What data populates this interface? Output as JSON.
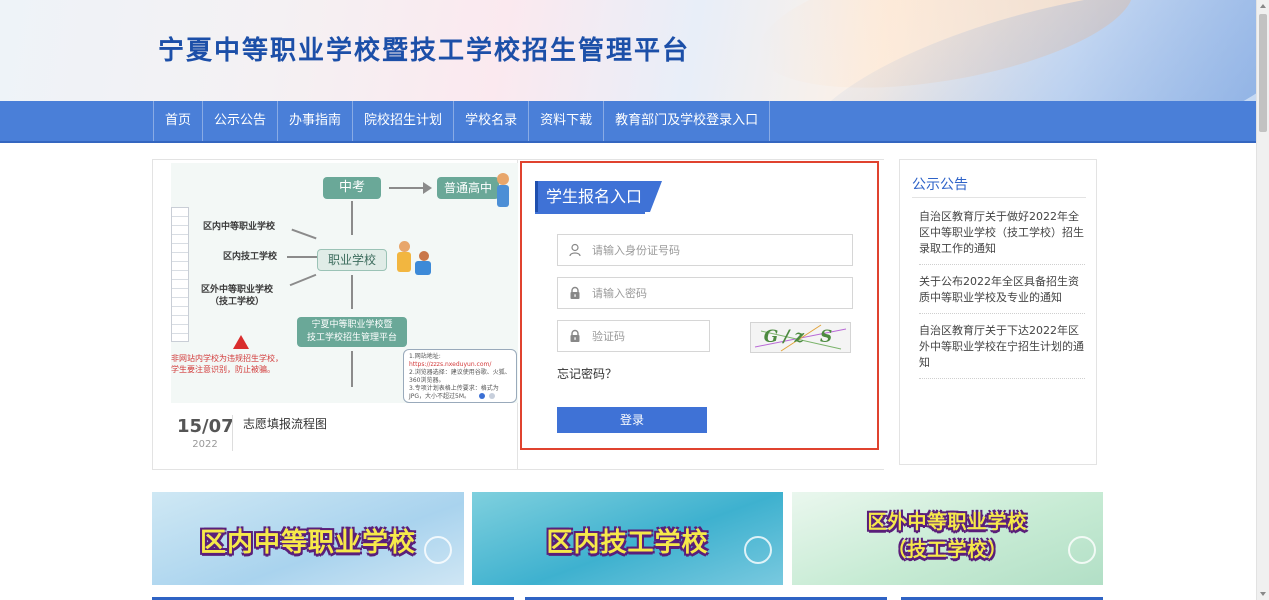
{
  "header": {
    "site_title": "宁夏中等职业学校暨技工学校招生管理平台"
  },
  "nav": {
    "items": [
      {
        "label": "首页"
      },
      {
        "label": "公示公告"
      },
      {
        "label": "办事指南"
      },
      {
        "label": "院校招生计划"
      },
      {
        "label": "学校名录"
      },
      {
        "label": "资料下载"
      },
      {
        "label": "教育部门及学校登录入口"
      }
    ]
  },
  "slide": {
    "flowchart": {
      "top_box": "中考",
      "right_box": "普通高中",
      "center_box": "职业学校",
      "bottom_box_line1": "宁夏中等职业学校暨",
      "bottom_box_line2": "技工学校招生管理平台",
      "label_1": "区内中等职业学校",
      "label_2": "区内技工学校",
      "label_3_line1": "区外中等职业学校",
      "label_3_line2": "（技工学校）",
      "warning_line1": "非网站内学校为违规招生学校，",
      "warning_line2": "学生要注意识别，防止被骗。",
      "note_line1": "1.网站地址:",
      "note_line2": "https://zzzs.nxeduyun.com/",
      "note_line3": "2.浏览器选择：建议使用谷歌、火狐、360浏览器。",
      "note_line4": "3.专项计划表格上传要求：格式为JPG，大小不超过5M。"
    },
    "date_day_month": "15/07",
    "date_year": "2022",
    "caption": "志愿填报流程图"
  },
  "login": {
    "title": "学生报名入口",
    "id_placeholder": "请输入身份证号码",
    "password_placeholder": "请输入密码",
    "captcha_placeholder": "验证码",
    "captcha_text": "G/z S",
    "forgot_label": "忘记密码？",
    "login_label": "登录"
  },
  "notices": {
    "title": "公示公告",
    "items": [
      {
        "text": "自治区教育厅关于做好2022年全区中等职业学校（技工学校）招生录取工作的通知"
      },
      {
        "text": "关于公布2022年全区具备招生资质中等职业学校及专业的通知"
      },
      {
        "text": "自治区教育厅关于下达2022年区外中等职业学校在宁招生计划的通知"
      }
    ]
  },
  "banners": {
    "b1": "区内中等职业学校",
    "b2": "区内技工学校",
    "b3_line1": "区外中等职业学校",
    "b3_line2": "（技工学校）"
  },
  "colors": {
    "brand_blue": "#4a7fd8",
    "title_blue": "#1c4fa8",
    "highlight_red": "#e0432f",
    "banner_text": "#f6e94a"
  },
  "icons": {
    "id_field": "user-icon",
    "password_field": "lock-icon",
    "captcha_field": "lock-icon",
    "banner_decoration": "magnifier-icon"
  }
}
